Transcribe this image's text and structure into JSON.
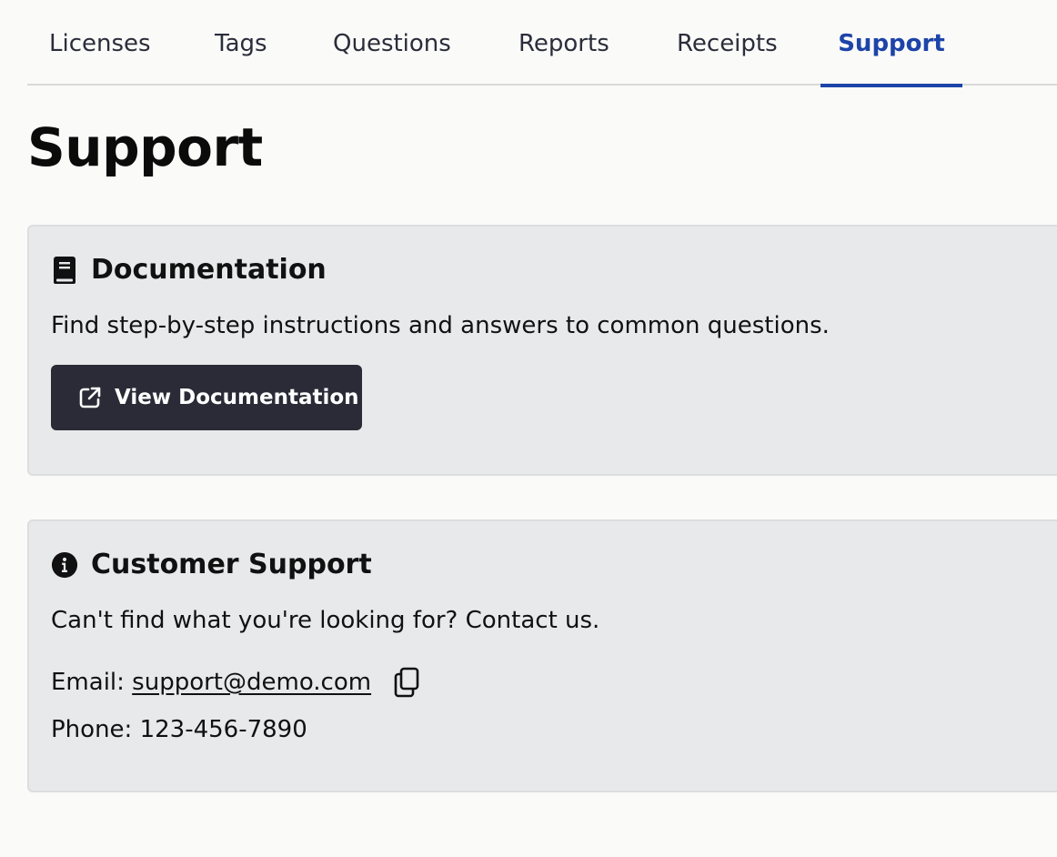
{
  "tabs": [
    {
      "label": "Licenses"
    },
    {
      "label": "Tags"
    },
    {
      "label": "Questions"
    },
    {
      "label": "Reports"
    },
    {
      "label": "Receipts"
    },
    {
      "label": "Support",
      "active": true
    }
  ],
  "page": {
    "title": "Support"
  },
  "documentation": {
    "icon": "book-icon",
    "title": "Documentation",
    "description": "Find step-by-step instructions and answers to common questions.",
    "button": {
      "icon": "external-link-icon",
      "label": "View Documentation"
    }
  },
  "customer_support": {
    "icon": "info-circle-icon",
    "title": "Customer Support",
    "description": "Can't find what you're looking for? Contact us.",
    "email_label": "Email:",
    "email": "support@demo.com",
    "copy_icon": "copy-icon",
    "phone_label": "Phone:",
    "phone": "123-456-7890"
  },
  "colors": {
    "accent": "#1d44a8",
    "button_bg": "#2a2b37",
    "card_bg": "#e8e9eb",
    "page_bg": "#fafaf9"
  }
}
